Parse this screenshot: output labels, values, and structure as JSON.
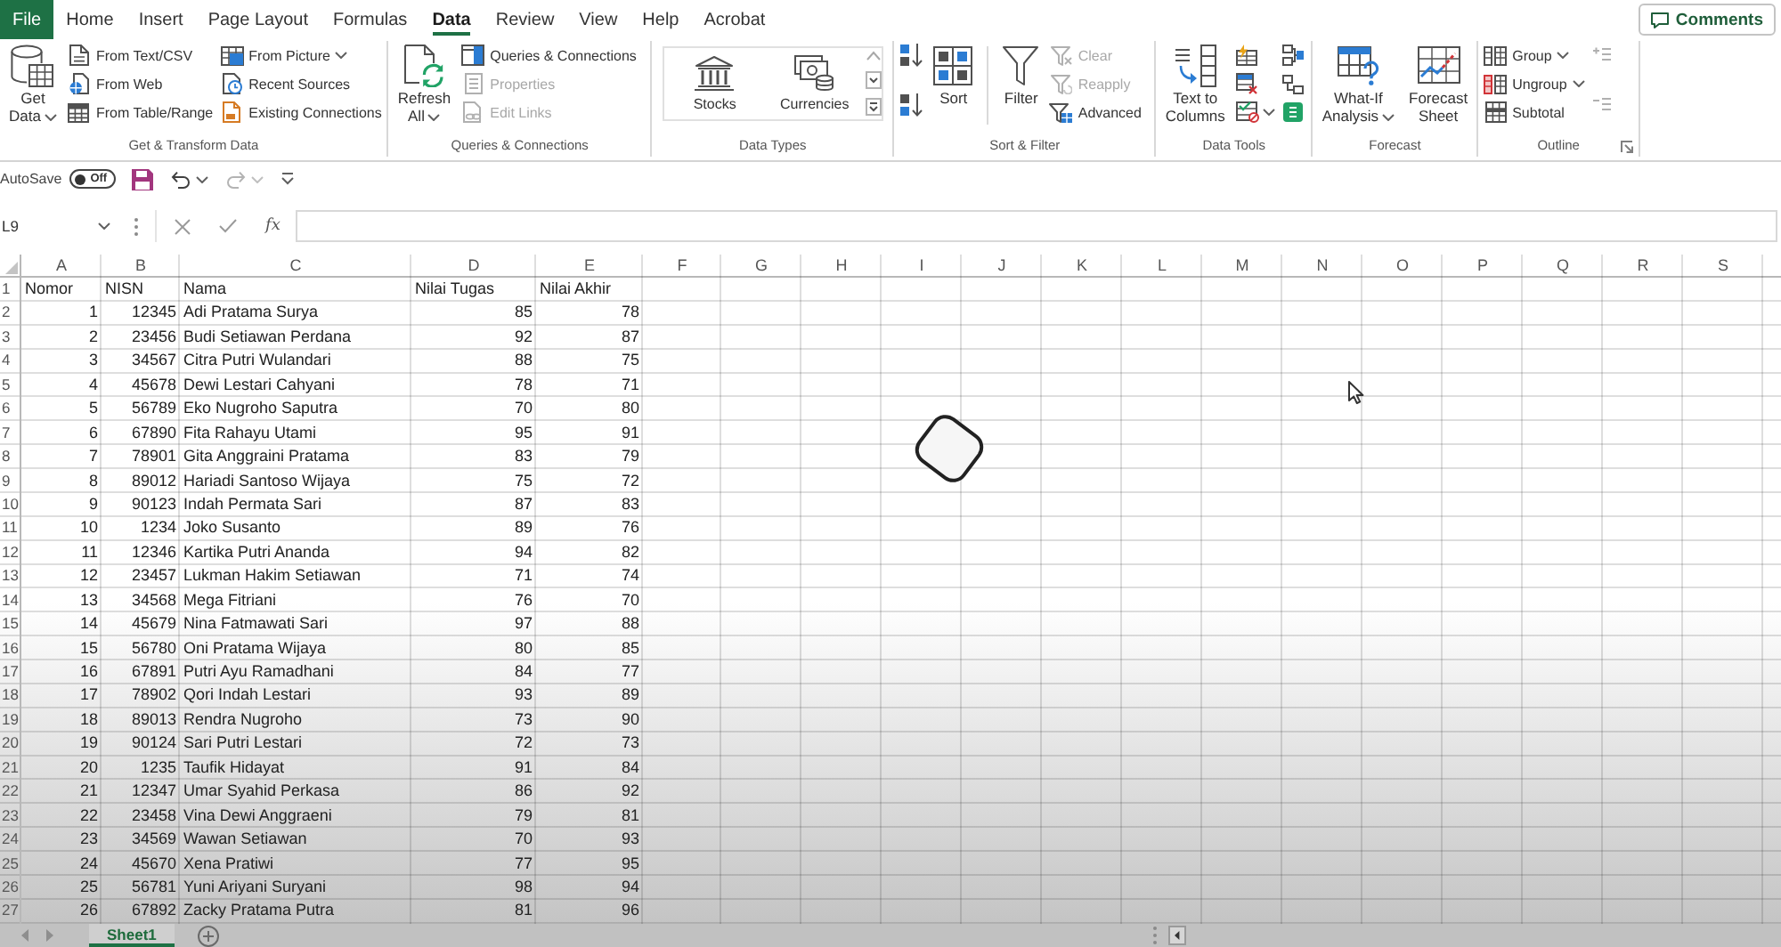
{
  "tabs": [
    {
      "label": "File",
      "kind": "file",
      "selected": false
    },
    {
      "label": "Home",
      "kind": "tab",
      "selected": false
    },
    {
      "label": "Insert",
      "kind": "tab",
      "selected": false
    },
    {
      "label": "Page Layout",
      "kind": "tab",
      "selected": false
    },
    {
      "label": "Formulas",
      "kind": "tab",
      "selected": false
    },
    {
      "label": "Data",
      "kind": "tab",
      "selected": true
    },
    {
      "label": "Review",
      "kind": "tab",
      "selected": false
    },
    {
      "label": "View",
      "kind": "tab",
      "selected": false
    },
    {
      "label": "Help",
      "kind": "tab",
      "selected": false
    },
    {
      "label": "Acrobat",
      "kind": "tab",
      "selected": false
    }
  ],
  "comments_button": {
    "label": "Comments"
  },
  "ribbon": {
    "groups": [
      {
        "label": "Get & Transform Data",
        "launcher": false,
        "items": [
          {
            "kind": "large",
            "label": "Get Data",
            "dropdown": true,
            "disabled": false
          },
          {
            "kind": "small",
            "label": "From Text/CSV",
            "dropdown": false,
            "disabled": false
          },
          {
            "kind": "small",
            "label": "From Web",
            "dropdown": false,
            "disabled": false
          },
          {
            "kind": "small",
            "label": "From Table/Range",
            "dropdown": false,
            "disabled": false
          },
          {
            "kind": "small",
            "label": "From Picture",
            "dropdown": true,
            "disabled": false
          },
          {
            "kind": "small",
            "label": "Recent Sources",
            "dropdown": false,
            "disabled": false
          },
          {
            "kind": "small",
            "label": "Existing Connections",
            "dropdown": false,
            "disabled": false
          }
        ]
      },
      {
        "label": "Queries & Connections",
        "launcher": false,
        "items": [
          {
            "kind": "large",
            "label": "Refresh All",
            "dropdown": true,
            "disabled": false
          },
          {
            "kind": "small",
            "label": "Queries & Connections",
            "dropdown": false,
            "disabled": false
          },
          {
            "kind": "small",
            "label": "Properties",
            "dropdown": false,
            "disabled": true
          },
          {
            "kind": "small",
            "label": "Edit Links",
            "dropdown": false,
            "disabled": true
          }
        ]
      },
      {
        "label": "Data Types",
        "launcher": false,
        "items": [
          {
            "kind": "gallery",
            "options": [
              {
                "label": "Stocks"
              },
              {
                "label": "Currencies"
              }
            ]
          }
        ]
      },
      {
        "label": "Sort & Filter",
        "launcher": false,
        "items": [
          {
            "kind": "icon",
            "dropdown": false,
            "disabled": false
          },
          {
            "kind": "icon",
            "dropdown": false,
            "disabled": false
          },
          {
            "kind": "large",
            "label": "Sort",
            "dropdown": false,
            "disabled": false
          },
          {
            "kind": "separator"
          },
          {
            "kind": "large",
            "label": "Filter",
            "dropdown": false,
            "disabled": false
          },
          {
            "kind": "small",
            "label": "Clear",
            "dropdown": false,
            "disabled": true
          },
          {
            "kind": "small",
            "label": "Reapply",
            "dropdown": false,
            "disabled": true
          },
          {
            "kind": "small",
            "label": "Advanced",
            "dropdown": false,
            "disabled": false
          }
        ]
      },
      {
        "label": "Data Tools",
        "launcher": false,
        "items": [
          {
            "kind": "large",
            "label": "Text to Columns",
            "dropdown": false,
            "disabled": false
          },
          {
            "kind": "icon",
            "dropdown": false,
            "disabled": false
          },
          {
            "kind": "icon",
            "dropdown": false,
            "disabled": false
          },
          {
            "kind": "icon",
            "dropdown": true,
            "disabled": false
          },
          {
            "kind": "icon",
            "dropdown": false,
            "disabled": false
          },
          {
            "kind": "icon",
            "dropdown": false,
            "disabled": false
          },
          {
            "kind": "icon",
            "dropdown": false,
            "disabled": false
          }
        ]
      },
      {
        "label": "Forecast",
        "launcher": false,
        "items": [
          {
            "kind": "large",
            "label": "What-If Analysis",
            "dropdown": true,
            "disabled": false
          },
          {
            "kind": "large",
            "label": "Forecast Sheet",
            "dropdown": false,
            "disabled": false
          }
        ]
      },
      {
        "label": "Outline",
        "launcher": true,
        "items": [
          {
            "kind": "small",
            "label": "Group",
            "dropdown": true,
            "disabled": false
          },
          {
            "kind": "small",
            "label": "Ungroup",
            "dropdown": true,
            "disabled": false
          },
          {
            "kind": "small",
            "label": "Subtotal",
            "dropdown": false,
            "disabled": false
          },
          {
            "kind": "icon",
            "dropdown": false,
            "disabled": true
          },
          {
            "kind": "icon",
            "dropdown": false,
            "disabled": true
          }
        ]
      }
    ]
  },
  "quick_access": {
    "autosave": {
      "label": "AutoSave",
      "state_label": "Off",
      "on": false
    },
    "buttons": [
      {
        "kind": "save",
        "dropdown": false,
        "disabled": false
      },
      {
        "kind": "undo",
        "dropdown": true,
        "disabled": false
      },
      {
        "kind": "redo",
        "dropdown": true,
        "disabled": true
      },
      {
        "kind": "customize",
        "dropdown": false,
        "disabled": false
      }
    ]
  },
  "formula_bar": {
    "name_box": "L9",
    "function_button": "fx"
  },
  "sheet": {
    "columns": [
      {
        "label": "A",
        "kind": "number"
      },
      {
        "label": "B",
        "kind": "number"
      },
      {
        "label": "C",
        "kind": "text"
      },
      {
        "label": "D",
        "kind": "number"
      },
      {
        "label": "E",
        "kind": "number"
      },
      {
        "label": "F"
      },
      {
        "label": "G"
      },
      {
        "label": "H"
      },
      {
        "label": "I"
      },
      {
        "label": "J"
      },
      {
        "label": "K"
      },
      {
        "label": "L"
      },
      {
        "label": "M"
      },
      {
        "label": "N"
      },
      {
        "label": "O"
      },
      {
        "label": "P"
      },
      {
        "label": "Q"
      },
      {
        "label": "R"
      },
      {
        "label": "S"
      }
    ],
    "rows": [
      {
        "number": "1",
        "kind": "header",
        "cells": [
          "Nomor",
          "NISN",
          "Nama",
          "Nilai Tugas",
          "Nilai Akhir"
        ]
      },
      {
        "number": "2",
        "kind": "data",
        "cells": [
          "1",
          "12345",
          "Adi Pratama Surya",
          "85",
          "78"
        ]
      },
      {
        "number": "3",
        "kind": "data",
        "cells": [
          "2",
          "23456",
          "Budi Setiawan Perdana",
          "92",
          "87"
        ]
      },
      {
        "number": "4",
        "kind": "data",
        "cells": [
          "3",
          "34567",
          "Citra Putri Wulandari",
          "88",
          "75"
        ]
      },
      {
        "number": "5",
        "kind": "data",
        "cells": [
          "4",
          "45678",
          "Dewi Lestari Cahyani",
          "78",
          "71"
        ]
      },
      {
        "number": "6",
        "kind": "data",
        "cells": [
          "5",
          "56789",
          "Eko Nugroho Saputra",
          "70",
          "80"
        ]
      },
      {
        "number": "7",
        "kind": "data",
        "cells": [
          "6",
          "67890",
          "Fita Rahayu Utami",
          "95",
          "91"
        ]
      },
      {
        "number": "8",
        "kind": "data",
        "cells": [
          "7",
          "78901",
          "Gita Anggraini Pratama",
          "83",
          "79"
        ]
      },
      {
        "number": "9",
        "kind": "data",
        "cells": [
          "8",
          "89012",
          "Hariadi Santoso Wijaya",
          "75",
          "72"
        ]
      },
      {
        "number": "10",
        "kind": "data",
        "cells": [
          "9",
          "90123",
          "Indah Permata Sari",
          "87",
          "83"
        ]
      },
      {
        "number": "11",
        "kind": "data",
        "cells": [
          "10",
          "1234",
          "Joko Susanto",
          "89",
          "76"
        ]
      },
      {
        "number": "12",
        "kind": "data",
        "cells": [
          "11",
          "12346",
          "Kartika Putri Ananda",
          "94",
          "82"
        ]
      },
      {
        "number": "13",
        "kind": "data",
        "cells": [
          "12",
          "23457",
          "Lukman Hakim Setiawan",
          "71",
          "74"
        ]
      },
      {
        "number": "14",
        "kind": "data",
        "cells": [
          "13",
          "34568",
          "Mega Fitriani",
          "76",
          "70"
        ]
      },
      {
        "number": "15",
        "kind": "data",
        "cells": [
          "14",
          "45679",
          "Nina Fatmawati Sari",
          "97",
          "88"
        ]
      },
      {
        "number": "16",
        "kind": "data",
        "cells": [
          "15",
          "56780",
          "Oni Pratama Wijaya",
          "80",
          "85"
        ]
      },
      {
        "number": "17",
        "kind": "data",
        "cells": [
          "16",
          "67891",
          "Putri Ayu Ramadhani",
          "84",
          "77"
        ]
      },
      {
        "number": "18",
        "kind": "data",
        "cells": [
          "17",
          "78902",
          "Qori Indah Lestari",
          "93",
          "89"
        ]
      },
      {
        "number": "19",
        "kind": "data",
        "cells": [
          "18",
          "89013",
          "Rendra Nugroho",
          "73",
          "90"
        ]
      },
      {
        "number": "20",
        "kind": "data",
        "cells": [
          "19",
          "90124",
          "Sari Putri Lestari",
          "72",
          "73"
        ]
      },
      {
        "number": "21",
        "kind": "data",
        "cells": [
          "20",
          "1235",
          "Taufik Hidayat",
          "91",
          "84"
        ]
      },
      {
        "number": "22",
        "kind": "data",
        "cells": [
          "21",
          "12347",
          "Umar Syahid Perkasa",
          "86",
          "92"
        ]
      },
      {
        "number": "23",
        "kind": "data",
        "cells": [
          "22",
          "23458",
          "Vina Dewi Anggraeni",
          "79",
          "81"
        ]
      },
      {
        "number": "24",
        "kind": "data",
        "cells": [
          "23",
          "34569",
          "Wawan Setiawan",
          "70",
          "93"
        ]
      },
      {
        "number": "25",
        "kind": "data",
        "cells": [
          "24",
          "45670",
          "Xena Pratiwi",
          "77",
          "95"
        ]
      },
      {
        "number": "26",
        "kind": "data",
        "cells": [
          "25",
          "56781",
          "Yuni Ariyani Suryani",
          "98",
          "94"
        ]
      },
      {
        "number": "27",
        "kind": "data",
        "cells": [
          "26",
          "67892",
          "Zacky Pratama Putra",
          "81",
          "96"
        ]
      }
    ]
  },
  "sheet_tabs": [
    {
      "label": "Sheet1",
      "selected": true
    }
  ]
}
